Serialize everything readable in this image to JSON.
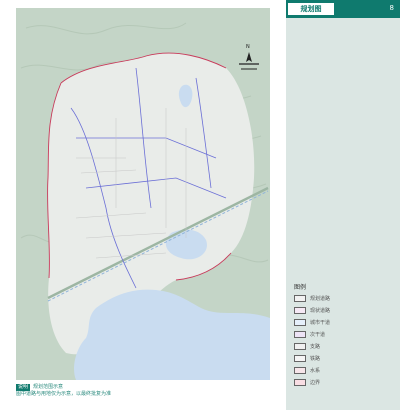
{
  "header": {
    "title": "规划图",
    "page_number": "8"
  },
  "legend": {
    "title": "图例",
    "items": [
      {
        "label": "规划道路",
        "color": "#f2f2f2"
      },
      {
        "label": "现状道路",
        "color": "#f6e9f5"
      },
      {
        "label": "城市干道",
        "color": "#e6f0fb"
      },
      {
        "label": "次干道",
        "color": "#ede3f6"
      },
      {
        "label": "支路",
        "color": "#f0f0f0"
      },
      {
        "label": "铁路",
        "color": "#f5f5f5"
      },
      {
        "label": "水系",
        "color": "#f7e6ea"
      },
      {
        "label": "边界",
        "color": "#f8dde3"
      }
    ]
  },
  "caption": {
    "tag": "说明",
    "line1": "规划范围示意",
    "line2": "图中道路与用地仅为示意，以最终批复为准"
  },
  "map": {
    "land": "#e9ece9",
    "water": "#c9dcf0",
    "hill": "#b9cdbd"
  },
  "compass": {
    "label": "N"
  }
}
